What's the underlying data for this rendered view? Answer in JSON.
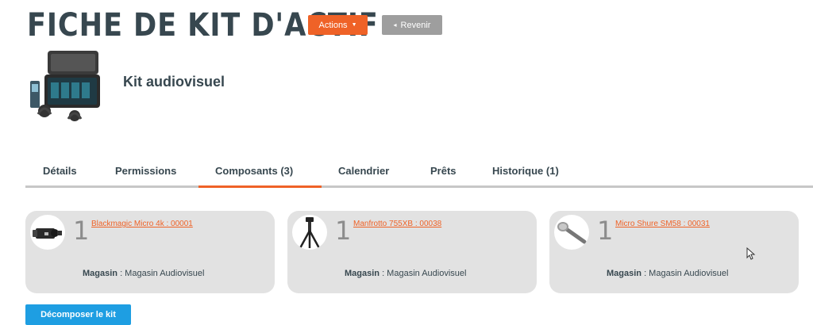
{
  "header": {
    "title": "FICHE DE KIT D'ACTIF",
    "actions_label": "Actions",
    "back_label": "Revenir",
    "back_arrow": "◂",
    "actions_caret": "▼"
  },
  "kit": {
    "name": "Kit audiovisuel",
    "image_icon": "equipment-case-icon"
  },
  "tabs": [
    {
      "label": "Détails"
    },
    {
      "label": "Permissions"
    },
    {
      "label": "Composants (3)",
      "active": true
    },
    {
      "label": "Calendrier"
    },
    {
      "label": "Prêts"
    },
    {
      "label": "Historique (1)"
    }
  ],
  "components": [
    {
      "quantity": "1",
      "name": "Blackmagic Micro 4k : 00001",
      "location_label": "Magasin",
      "location_value": " : Magasin Audiovisuel",
      "icon": "camera-icon"
    },
    {
      "quantity": "1",
      "name": "Manfrotto 755XB : 00038",
      "location_label": "Magasin",
      "location_value": " : Magasin Audiovisuel",
      "icon": "tripod-icon"
    },
    {
      "quantity": "1",
      "name": "Micro Shure SM58 : 00031",
      "location_label": "Magasin",
      "location_value": " : Magasin Audiovisuel",
      "icon": "microphone-icon"
    }
  ],
  "footer": {
    "decompose_label": "Décomposer le kit"
  },
  "colors": {
    "accent": "#ef6227",
    "secondary": "#9e9e9e",
    "primary_button": "#1e9ee2",
    "card_bg": "#e2e2e2",
    "title": "#37474f"
  }
}
